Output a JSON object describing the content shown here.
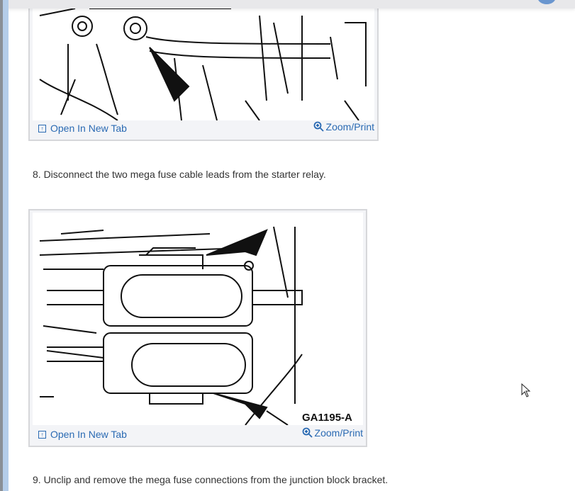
{
  "figures": [
    {
      "open_label": "Open In New Tab",
      "zoom_label": "Zoom/Print"
    },
    {
      "open_label": "Open In New Tab",
      "zoom_label": "Zoom/Print",
      "caption": "GA1195-A"
    }
  ],
  "steps": [
    "8. Disconnect the two mega fuse cable leads from the starter relay.",
    "9. Unclip and remove the mega fuse connections from the junction block bracket."
  ],
  "colors": {
    "link": "#2a6ab3",
    "text": "#333333"
  }
}
